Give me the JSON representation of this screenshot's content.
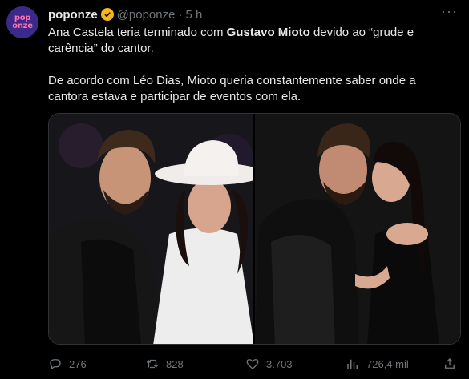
{
  "author": {
    "name": "poponze",
    "handle": "@poponze",
    "separator": "·",
    "time": "5 h",
    "avatar_text_top": "pop",
    "avatar_text_bottom": "onze"
  },
  "tweet": {
    "line1_part1": "Ana Castela teria terminado com ",
    "line1_bold": "Gustavo Mioto",
    "line1_part2": " devido ao “grude e carência” do cantor.",
    "line2": "De acordo com Léo Dias, Mioto queria constantemente saber onde a cantora estava e participar de eventos com ela."
  },
  "actions": {
    "replies": "276",
    "retweets": "828",
    "likes": "3.703",
    "views": "726,4 mil"
  },
  "colors": {
    "background": "#000000",
    "text": "#e7e9ea",
    "muted": "#71767b",
    "verified": "#f4b41a",
    "avatar_bg": "#3b2a8a",
    "avatar_text": "#ff6fb1"
  }
}
